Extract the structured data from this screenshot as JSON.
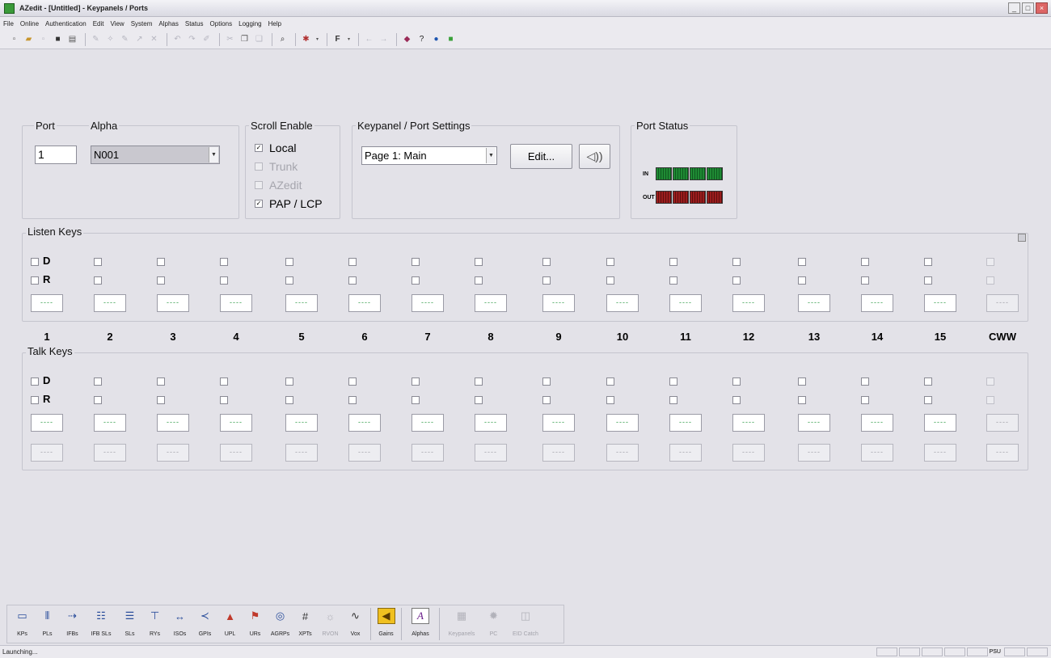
{
  "window": {
    "title": "AZedit - [Untitled] - Keypanels / Ports",
    "btn_min": "_",
    "btn_max": "□",
    "btn_close": "×"
  },
  "menu": [
    "File",
    "Online",
    "Authentication",
    "Edit",
    "View",
    "System",
    "Alphas",
    "Status",
    "Options",
    "Logging",
    "Help"
  ],
  "port_group": {
    "port_label": "Port",
    "port_value": "1",
    "alpha_label": "Alpha",
    "alpha_value": "N001"
  },
  "scroll_enable": {
    "label": "Scroll Enable",
    "local": "Local",
    "trunk": "Trunk",
    "azedit": "AZedit",
    "pap_lcp": "PAP / LCP"
  },
  "settings": {
    "label": "Keypanel / Port Settings",
    "page_value": "Page 1: Main",
    "edit_button": "Edit..."
  },
  "port_status": {
    "label": "Port Status",
    "in_label": "IN",
    "out_label": "OUT"
  },
  "keys": {
    "listen_label": "Listen Keys",
    "talk_label": "Talk Keys",
    "d_label": "D",
    "r_label": "R",
    "placeholder": "----",
    "columns": [
      "1",
      "2",
      "3",
      "4",
      "5",
      "6",
      "7",
      "8",
      "9",
      "10",
      "11",
      "12",
      "13",
      "14",
      "15",
      "CWW"
    ]
  },
  "dock": {
    "kps": "KPs",
    "pls": "PLs",
    "ifbs": "IFBs",
    "ifbsls": "IFB SLs",
    "sls": "SLs",
    "rys": "RYs",
    "isos": "ISOs",
    "gpis": "GPIs",
    "upl": "UPL",
    "urs": "URs",
    "agrps": "AGRPs",
    "xpts": "XPTs",
    "rvon": "RVON",
    "vox": "Vox",
    "gains": "Gains",
    "alphas": "Alphas",
    "keypanels": "Keypanels",
    "pc": "PC",
    "eid": "EID Catch"
  },
  "status": {
    "text": "Launching...",
    "pane_label": "PSU"
  }
}
